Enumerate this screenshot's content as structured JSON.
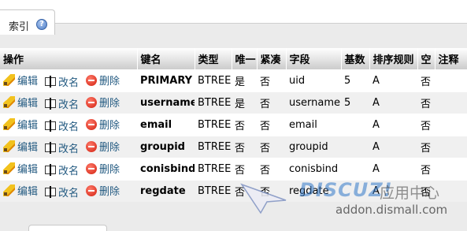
{
  "tab": {
    "label": "索引",
    "help_icon": "help-icon"
  },
  "table": {
    "headers": [
      "操作",
      "键名",
      "类型",
      "唯一",
      "紧凑",
      "字段",
      "基数",
      "排序规则",
      "空",
      "注释"
    ],
    "action_labels": {
      "edit": "编辑",
      "rename": "改名",
      "drop": "删除"
    },
    "rows": [
      {
        "keyname": "PRIMARY",
        "type": "BTREE",
        "unique": "是",
        "packed": "否",
        "column": "uid",
        "cardinality": "5",
        "collation": "A",
        "null": "否",
        "comment": ""
      },
      {
        "keyname": "username",
        "type": "BTREE",
        "unique": "是",
        "packed": "否",
        "column": "username",
        "cardinality": "5",
        "collation": "A",
        "null": "否",
        "comment": ""
      },
      {
        "keyname": "email",
        "type": "BTREE",
        "unique": "否",
        "packed": "否",
        "column": "email",
        "cardinality": "",
        "collation": "A",
        "null": "否",
        "comment": ""
      },
      {
        "keyname": "groupid",
        "type": "BTREE",
        "unique": "否",
        "packed": "否",
        "column": "groupid",
        "cardinality": "",
        "collation": "A",
        "null": "否",
        "comment": ""
      },
      {
        "keyname": "conisbind",
        "type": "BTREE",
        "unique": "否",
        "packed": "否",
        "column": "conisbind",
        "cardinality": "",
        "collation": "A",
        "null": "否",
        "comment": ""
      },
      {
        "keyname": "regdate",
        "type": "BTREE",
        "unique": "否",
        "packed": "否",
        "column": "regdate",
        "cardinality": "",
        "collation": "A",
        "null": "否",
        "comment": ""
      }
    ]
  },
  "watermark": {
    "brand": "DISCUZ!",
    "brand_cn": "应用中心",
    "url": "addon.dismall.com"
  },
  "colors": {
    "action_link": "#235a81",
    "header_gradient_top": "#ffffff",
    "header_gradient_bottom": "#cccccc",
    "panel_background": "#ebebeb"
  }
}
